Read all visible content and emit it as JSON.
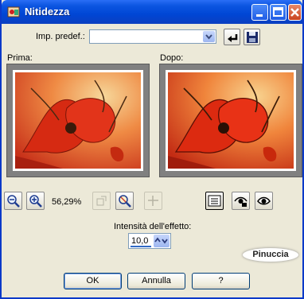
{
  "window": {
    "title": "Nitidezza"
  },
  "preset": {
    "label": "Imp. predef.:",
    "value": ""
  },
  "preview": {
    "before_label": "Prima:",
    "after_label": "Dopo:"
  },
  "zoom": {
    "level": "56,29%"
  },
  "effect": {
    "label": "Intensità dell'effetto:",
    "value": "10,0"
  },
  "watermark": {
    "text": "Pinuccia"
  },
  "buttons": {
    "ok": "OK",
    "cancel": "Annulla",
    "help": "?"
  },
  "colors": {
    "title_bar": "#0046d5",
    "dialog_bg": "#ece9d8",
    "poppy_red": "#d62a12",
    "frame_gray": "#808080"
  }
}
